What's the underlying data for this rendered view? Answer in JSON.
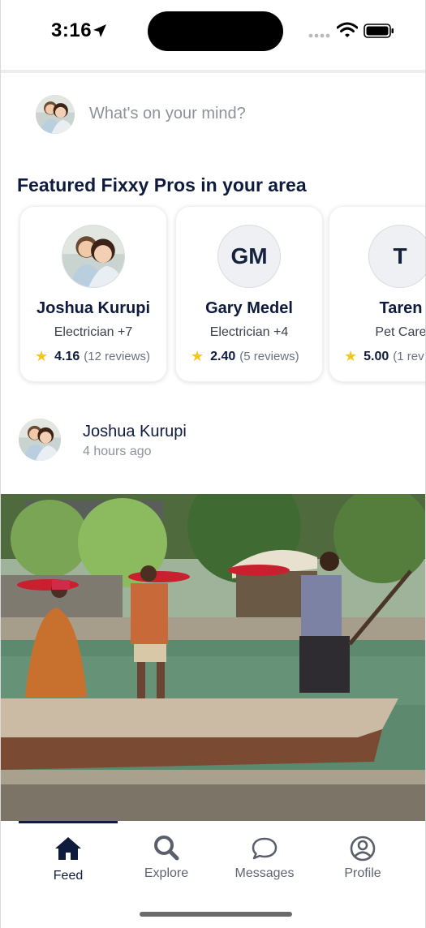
{
  "status_bar": {
    "time": "3:16"
  },
  "composer": {
    "placeholder": "What's on your mind?"
  },
  "featured": {
    "title": "Featured Fixxy Pros in your area",
    "pros": [
      {
        "name": "Joshua Kurupi",
        "trade": "Electrician +7",
        "rating": "4.16",
        "reviews": "(12 reviews)",
        "initials": ""
      },
      {
        "name": "Gary Medel",
        "trade": "Electrician +4",
        "rating": "2.40",
        "reviews": "(5 reviews)",
        "initials": "GM"
      },
      {
        "name": "Taren",
        "trade": "Pet Care",
        "rating": "5.00",
        "reviews": "(1 rev",
        "initials": "T"
      }
    ]
  },
  "post": {
    "author": "Joshua Kurupi",
    "time": "4 hours ago"
  },
  "tabs": [
    {
      "label": "Feed",
      "icon": "home-icon",
      "active": true
    },
    {
      "label": "Explore",
      "icon": "search-icon",
      "active": false
    },
    {
      "label": "Messages",
      "icon": "chat-bubble-icon",
      "active": false
    },
    {
      "label": "Profile",
      "icon": "user-circle-icon",
      "active": false
    }
  ],
  "colors": {
    "primary": "#0f1b3d",
    "star": "#f5c518",
    "muted": "#8d929a"
  }
}
